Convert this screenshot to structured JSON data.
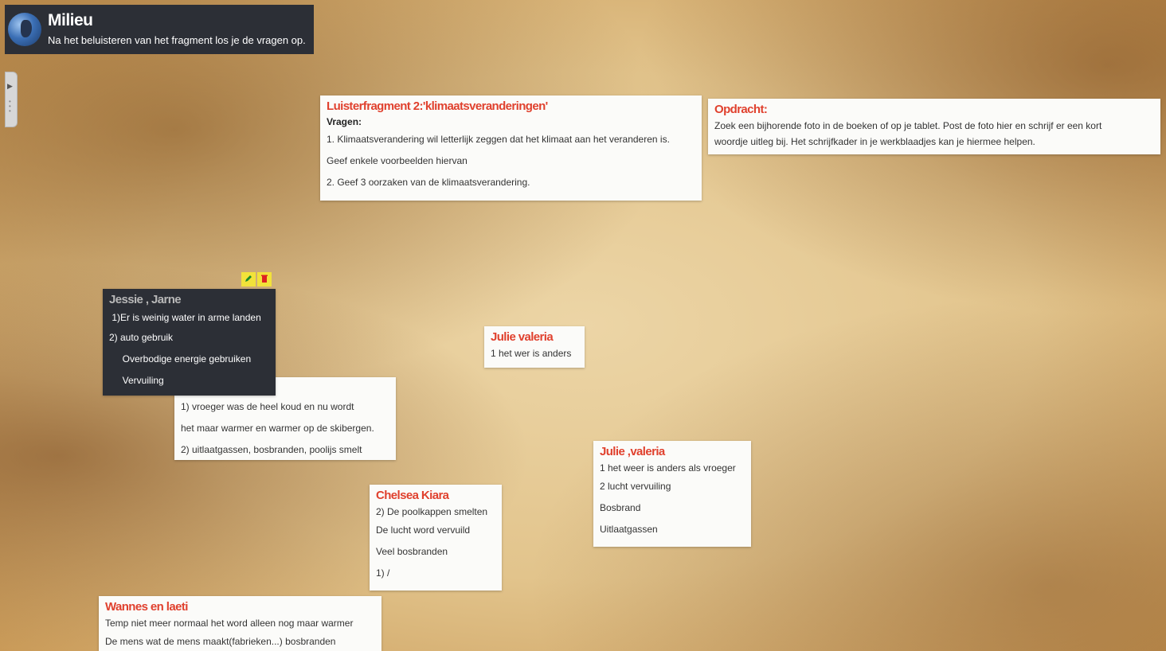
{
  "header": {
    "title": "Milieu",
    "subtitle": "Na het beluisteren van het fragment los je de vragen op."
  },
  "notes": {
    "luister": {
      "title": "Luisterfragment 2:'klimaatsveranderingen'",
      "subtitle": "Vragen",
      "lines": [
        "1. Klimaatsverandering wil letterlijk zeggen dat het klimaat aan het veranderen is.",
        "Geef enkele voorbeelden hiervan",
        "2. Geef 3 oorzaken van de klimaatsverandering."
      ]
    },
    "opdracht": {
      "title": "Opdracht:",
      "lines": [
        "Zoek een bijhorende foto in de boeken of op je tablet. Post de foto hier en schrijf er een kort",
        "woordje uitleg bij. Het schrijfkader in je werkblaadjes kan je hiermee helpen."
      ]
    },
    "jessie": {
      "title": "Jessie , Jarne",
      "lines": [
        " 1)Er is weinig water in arme landen",
        "2) auto gebruik",
        "     Overbodige energie gebruiken",
        "     Vervuiling"
      ]
    },
    "hidden": {
      "lines": [
        "1) vroeger was de heel koud en nu wordt",
        "het maar warmer en warmer op de skibergen.",
        "2) uitlaatgassen, bosbranden, poolijs smelt"
      ]
    },
    "julie1": {
      "title": "Julie valeria",
      "lines": [
        "1 het wer is anders"
      ]
    },
    "julie2": {
      "title": "Julie ,valeria",
      "lines": [
        "1 het weer is anders als vroeger",
        "2 lucht vervuiling",
        "Bosbrand",
        "Uitlaatgassen"
      ]
    },
    "chelsea": {
      "title": "Chelsea Kiara",
      "lines": [
        "2) De poolkappen smelten",
        "De lucht word vervuild",
        "Veel bosbranden",
        "1) /"
      ]
    },
    "wannes": {
      "title": "Wannes en laeti",
      "lines": [
        "Temp niet meer normaal het word alleen nog maar warmer",
        "De mens wat de mens maakt(fabrieken...) bosbranden"
      ]
    }
  },
  "icons": {
    "edit": "pencil-icon",
    "delete": "trash-icon",
    "logo": "globe-icon"
  },
  "colors": {
    "title_red": "#e0412e",
    "dark_panel": "#2c2f36",
    "action_yellow": "#f2e23a"
  }
}
